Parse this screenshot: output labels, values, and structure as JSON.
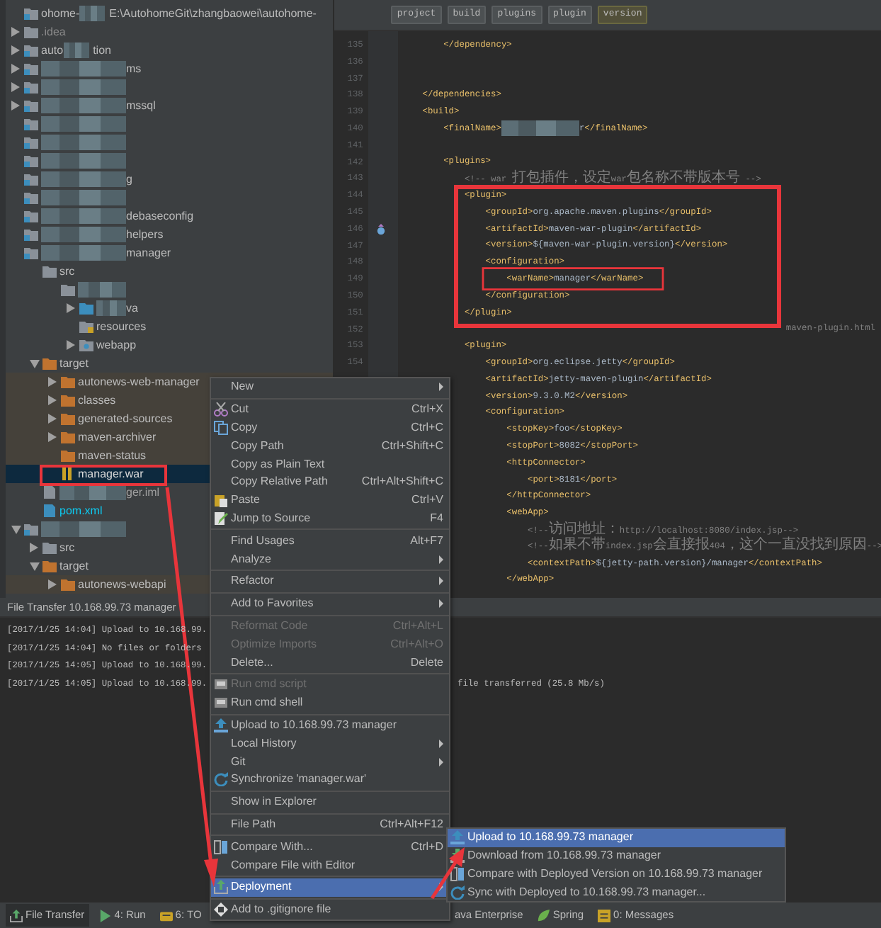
{
  "project_tree": {
    "items": [
      {
        "kind": "project",
        "prefix": "ohome-",
        "redacted": true,
        "label": "E:\\AutohomeGit\\zhangbaowei\\autohome-",
        "selected": false
      },
      {
        "kind": "folder",
        "label": ".idea",
        "expanded": false,
        "selected": false
      },
      {
        "kind": "module",
        "prefix": "auto",
        "redacted": true,
        "label": "tion",
        "expanded": false,
        "selected": false
      },
      {
        "kind": "module",
        "redacted": true,
        "label": "ms",
        "expanded": false,
        "selected": false
      },
      {
        "kind": "module",
        "redacted": true,
        "expanded": false,
        "selected": false
      },
      {
        "kind": "module",
        "redacted": true,
        "label": "mssql",
        "expanded": false,
        "selected": false
      },
      {
        "kind": "module",
        "redacted": true,
        "selected": false
      },
      {
        "kind": "module",
        "redacted": true,
        "selected": false
      },
      {
        "kind": "module",
        "redacted": true,
        "selected": false
      },
      {
        "kind": "module",
        "redacted": true,
        "label": "g",
        "selected": false
      },
      {
        "kind": "module",
        "redacted": true,
        "selected": false
      },
      {
        "kind": "module",
        "redacted": true,
        "label": "debaseconfig",
        "selected": false
      },
      {
        "kind": "module",
        "redacted": true,
        "label": "helpers",
        "selected": false
      },
      {
        "kind": "module",
        "redacted": true,
        "label": "manager",
        "selected": false,
        "children": [
          {
            "kind": "folder",
            "label": "src",
            "selected": false,
            "children": [
              {
                "kind": "folder",
                "redacted": true,
                "selected": false,
                "children": [
                  {
                    "kind": "source",
                    "redacted": true,
                    "label": "va",
                    "expanded": false,
                    "selected": false
                  },
                  {
                    "kind": "resources",
                    "label": "resources",
                    "selected": false
                  },
                  {
                    "kind": "web",
                    "label": "webapp",
                    "expanded": false,
                    "selected": false
                  }
                ]
              }
            ]
          },
          {
            "kind": "excluded",
            "label": "target",
            "expanded": true,
            "selected": false,
            "children": [
              {
                "kind": "excluded",
                "label": "autonews-web-manager",
                "expanded": false,
                "selected": false
              },
              {
                "kind": "excluded",
                "label": "classes",
                "expanded": false,
                "selected": false
              },
              {
                "kind": "excluded",
                "label": "generated-sources",
                "expanded": false,
                "selected": false
              },
              {
                "kind": "excluded",
                "label": "maven-archiver",
                "expanded": false,
                "selected": false
              },
              {
                "kind": "excluded",
                "label": "maven-status",
                "selected": false
              },
              {
                "kind": "war",
                "label": "manager.war",
                "selected": true
              }
            ]
          },
          {
            "kind": "iml",
            "redacted": true,
            "label": "ger.iml",
            "selected": false
          },
          {
            "kind": "pom",
            "label": "pom.xml",
            "selected": false
          }
        ]
      },
      {
        "kind": "module",
        "redacted": true,
        "expanded": true,
        "selected": false,
        "children": [
          {
            "kind": "folder",
            "label": "src",
            "expanded": false,
            "selected": false
          },
          {
            "kind": "excluded",
            "label": "target",
            "expanded": true,
            "selected": false,
            "children": [
              {
                "kind": "excluded",
                "label": "autonews-webapi",
                "expanded": false,
                "selected": false
              }
            ]
          }
        ]
      }
    ]
  },
  "breadcrumbs": [
    {
      "label": "project",
      "selected": false
    },
    {
      "label": "build",
      "selected": false
    },
    {
      "label": "plugins",
      "selected": false
    },
    {
      "label": "plugin",
      "selected": false
    },
    {
      "label": "version",
      "selected": true
    }
  ],
  "code_lines": [
    {
      "number": "135",
      "text": "        </dependency>"
    },
    {
      "number": "136"
    },
    {
      "number": "137"
    },
    {
      "number": "138",
      "text": "    </dependencies>"
    },
    {
      "number": "139",
      "text": "    <build>"
    },
    {
      "number": "140",
      "text": "        <finalName>",
      "redacted": true,
      "text_after": "r</finalName>"
    },
    {
      "number": "141"
    },
    {
      "number": "142",
      "text": "        <plugins>"
    },
    {
      "number": "143",
      "text": "            <!-- war 打包插件，设定war包名称不带版本号 -->"
    },
    {
      "number": "144",
      "text": "            <plugin>"
    },
    {
      "number": "145",
      "text": "                <groupId>org.apache.maven.plugins</groupId>"
    },
    {
      "number": "146",
      "text": "                <artifactId>maven-war-plugin</artifactId>",
      "gutter_icon": true
    },
    {
      "number": "147",
      "text": "                <version>${maven-war-plugin.version}</version>"
    },
    {
      "number": "148",
      "text": "                <configuration>"
    },
    {
      "number": "149",
      "text": "                    <warName>manager</warName>"
    },
    {
      "number": "150",
      "text": "                </configuration>"
    },
    {
      "number": "151",
      "text": "            </plugin>"
    },
    {
      "number": "152",
      "text": "maven-plugin.html",
      "kind": "tail"
    },
    {
      "number": "153",
      "text": "            <plugin>"
    },
    {
      "number": "154",
      "text": "                <groupId>org.eclipse.jetty</groupId>"
    },
    {
      "text": "                <artifactId>jetty-maven-plugin</artifactId>"
    },
    {
      "text": "                <version>9.3.0.M2</version>"
    },
    {
      "text": "                <configuration>"
    },
    {
      "text": "                    <stopKey>foo</stopKey>"
    },
    {
      "text": "                    <stopPort>8082</stopPort>"
    },
    {
      "text": "                    <httpConnector>"
    },
    {
      "text": "                        <port>8181</port>"
    },
    {
      "text": "                    </httpConnector>"
    },
    {
      "text": "                    <webApp>"
    },
    {
      "text": "                        <!--访问地址：http://localhost:8080/index.jsp-->"
    },
    {
      "text": "                        <!--如果不带index.jsp会直接报404，这个一直没找到原因-->"
    },
    {
      "text": "                        <contextPath>${jetty-path.version}/manager</contextPath>"
    },
    {
      "text": "                    </webApp>"
    }
  ],
  "transfer_panel": {
    "title": "File Transfer 10.168.99.73 manager",
    "log": [
      {
        "text": "[2017/1/25 14:04] Upload to 10.168.99."
      },
      {
        "text": "[2017/1/25 14:04] No files or folders"
      },
      {
        "text": "[2017/1/25 14:05] Upload to 10.168.99."
      },
      {
        "text": "[2017/1/25 14:05] Upload to 10.168.99.",
        "text_after": "file transferred (25.8 Mb/s)"
      }
    ]
  },
  "toolbar": {
    "left": [
      {
        "label": "File Transfer",
        "kind": "transfer",
        "selected": true
      },
      {
        "label": "4: Run",
        "kind": "run",
        "selected": false
      },
      {
        "label": "6: TO",
        "kind": "todo",
        "selected": false
      }
    ],
    "right": [
      {
        "label": "ava Enterprise",
        "kind": "plain",
        "selected": false
      },
      {
        "label": "Spring",
        "kind": "spring",
        "selected": false
      },
      {
        "label": "0: Messages",
        "kind": "messages",
        "selected": false
      }
    ]
  },
  "context_menu": {
    "sections": [
      [
        {
          "label": "New",
          "kind": "plain",
          "submenu": true,
          "disabled": false,
          "selected": false
        }
      ],
      [
        {
          "label": "Cut",
          "shortcut": "Ctrl+X",
          "kind": "cut",
          "submenu": false,
          "disabled": false,
          "selected": false
        },
        {
          "label": "Copy",
          "shortcut": "Ctrl+C",
          "kind": "copy",
          "submenu": false,
          "disabled": false,
          "selected": false
        },
        {
          "label": "Copy Path",
          "shortcut": "Ctrl+Shift+C",
          "kind": "plain",
          "submenu": false,
          "disabled": false,
          "selected": false
        },
        {
          "label": "Copy as Plain Text",
          "kind": "plain",
          "submenu": false,
          "disabled": false,
          "selected": false
        },
        {
          "label": "Copy Relative Path",
          "shortcut": "Ctrl+Alt+Shift+C",
          "kind": "plain",
          "submenu": false,
          "disabled": false,
          "selected": false
        },
        {
          "label": "Paste",
          "shortcut": "Ctrl+V",
          "kind": "paste",
          "submenu": false,
          "disabled": false,
          "selected": false
        },
        {
          "label": "Jump to Source",
          "shortcut": "F4",
          "kind": "edit",
          "submenu": false,
          "disabled": false,
          "selected": false
        }
      ],
      [
        {
          "label": "Find Usages",
          "shortcut": "Alt+F7",
          "kind": "plain",
          "submenu": false,
          "disabled": false,
          "selected": false
        },
        {
          "label": "Analyze",
          "kind": "plain",
          "submenu": true,
          "disabled": false,
          "selected": false
        }
      ],
      [
        {
          "label": "Refactor",
          "kind": "plain",
          "submenu": true,
          "disabled": false,
          "selected": false
        }
      ],
      [
        {
          "label": "Add to Favorites",
          "kind": "plain",
          "submenu": true,
          "disabled": false,
          "selected": false
        }
      ],
      [
        {
          "label": "Reformat Code",
          "shortcut": "Ctrl+Alt+L",
          "kind": "plain",
          "submenu": false,
          "disabled": true,
          "selected": false
        },
        {
          "label": "Optimize Imports",
          "shortcut": "Ctrl+Alt+O",
          "kind": "plain",
          "submenu": false,
          "disabled": true,
          "selected": false
        },
        {
          "label": "Delete...",
          "shortcut": "Delete",
          "kind": "plain",
          "submenu": false,
          "disabled": false,
          "selected": false
        }
      ],
      [
        {
          "label": "Run cmd script",
          "kind": "terminal",
          "submenu": false,
          "disabled": true,
          "selected": false
        },
        {
          "label": "Run cmd shell",
          "kind": "terminal",
          "submenu": false,
          "disabled": false,
          "selected": false
        }
      ],
      [
        {
          "label": "Upload to 10.168.99.73 manager",
          "kind": "upload",
          "submenu": false,
          "disabled": false,
          "selected": false
        },
        {
          "label": "Local History",
          "kind": "plain",
          "submenu": true,
          "disabled": false,
          "selected": false
        },
        {
          "label": "Git",
          "kind": "plain",
          "submenu": true,
          "disabled": false,
          "selected": false
        },
        {
          "label": "Synchronize 'manager.war'",
          "kind": "sync",
          "submenu": false,
          "disabled": false,
          "selected": false
        }
      ],
      [
        {
          "label": "Show in Explorer",
          "kind": "plain",
          "submenu": false,
          "disabled": false,
          "selected": false
        }
      ],
      [
        {
          "label": "File Path",
          "shortcut": "Ctrl+Alt+F12",
          "kind": "plain",
          "submenu": false,
          "disabled": false,
          "selected": false
        }
      ],
      [
        {
          "label": "Compare With...",
          "shortcut": "Ctrl+D",
          "kind": "compare",
          "submenu": false,
          "disabled": false,
          "selected": false
        },
        {
          "label": "Compare File with Editor",
          "kind": "plain",
          "submenu": false,
          "disabled": false,
          "selected": false
        }
      ],
      [
        {
          "label": "Deployment",
          "kind": "deploy",
          "submenu": true,
          "disabled": false,
          "selected": true
        }
      ],
      [
        {
          "label": "Add to .gitignore file",
          "kind": "ignore",
          "submenu": false,
          "disabled": false,
          "selected": false
        }
      ]
    ]
  },
  "deployment_submenu": {
    "items": [
      {
        "label": "Upload to 10.168.99.73 manager",
        "kind": "upload",
        "selected": true
      },
      {
        "label": "Download from 10.168.99.73 manager",
        "kind": "download",
        "selected": false
      },
      {
        "label": "Compare with Deployed Version on 10.168.99.73 manager",
        "kind": "compare",
        "selected": false
      },
      {
        "label": "Sync with Deployed to 10.168.99.73 manager...",
        "kind": "sync",
        "selected": false
      }
    ]
  }
}
